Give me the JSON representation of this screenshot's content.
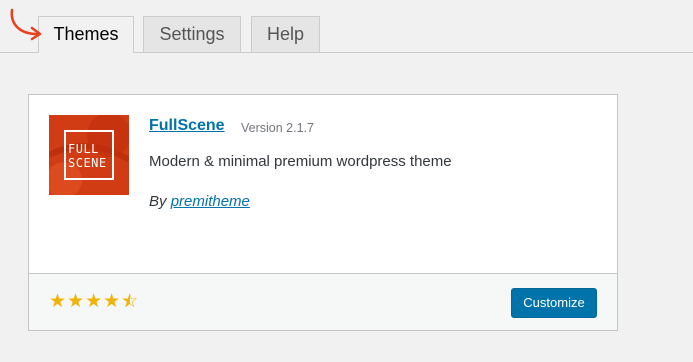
{
  "tabs": [
    {
      "label": "Themes",
      "active": true
    },
    {
      "label": "Settings",
      "active": false
    },
    {
      "label": "Help",
      "active": false
    }
  ],
  "theme": {
    "logo_text_line1": "FULL",
    "logo_text_line2": "SCENE",
    "name": "FullScene",
    "version": "Version 2.1.7",
    "description": "Modern & minimal premium wordpress theme",
    "by_label": "By",
    "author": "premitheme",
    "rating": 4.5,
    "rating_max": 5,
    "customize_label": "Customize"
  },
  "colors": {
    "accent": "#0073aa",
    "logo_bg": "#d23c14",
    "star": "#f0b30c",
    "arrow": "#e8401c"
  }
}
